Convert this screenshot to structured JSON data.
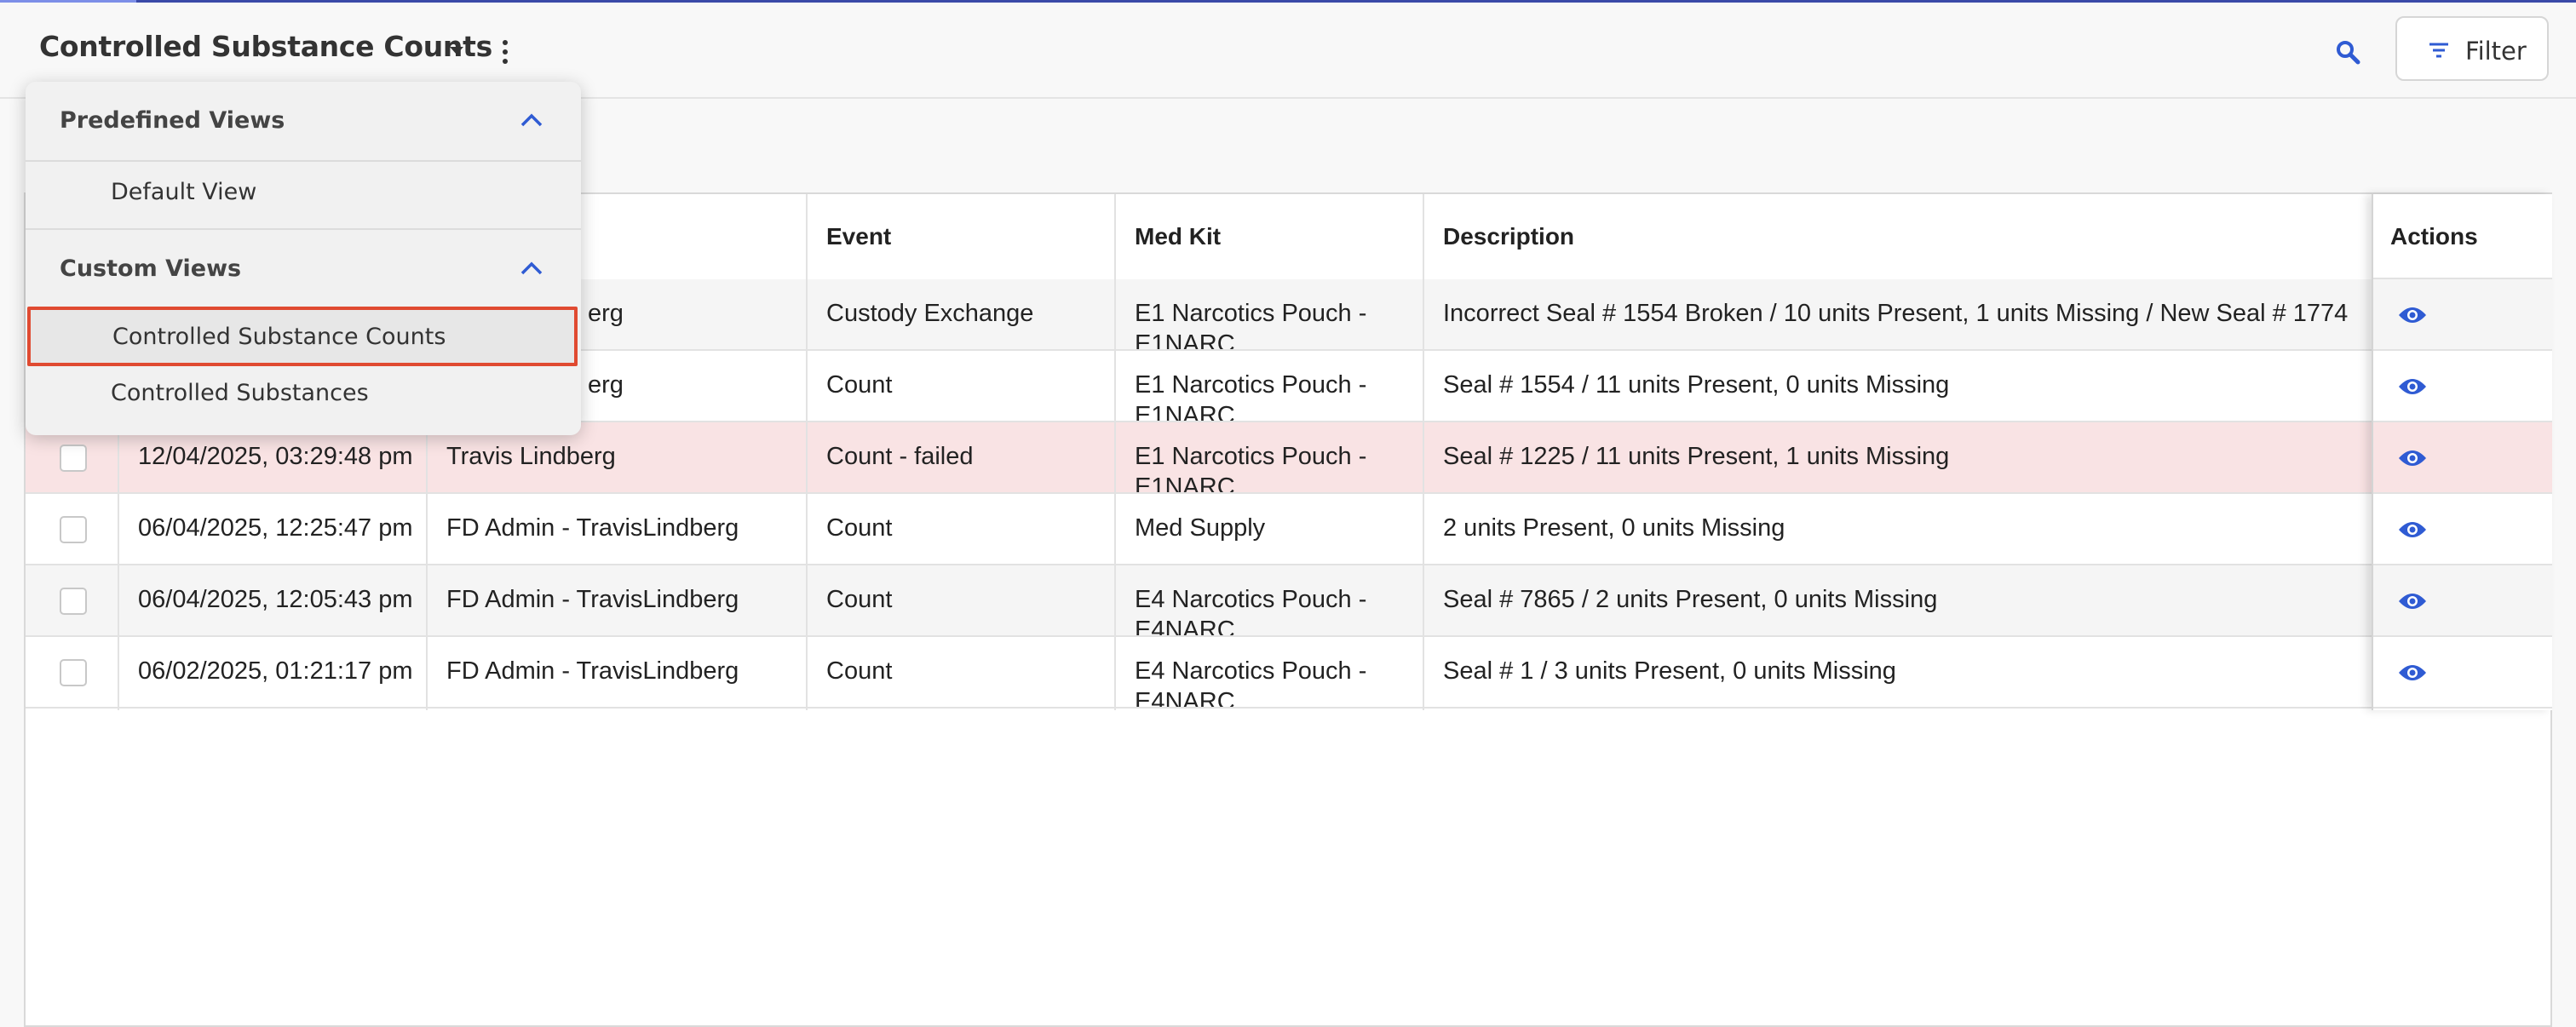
{
  "header": {
    "view_title": "Controlled Substance Counts",
    "filter_label": "Filter"
  },
  "menu": {
    "predefined_header": "Predefined Views",
    "predefined_items": [
      "Default View"
    ],
    "custom_header": "Custom Views",
    "custom_items": [
      "Controlled Substance Counts",
      "Controlled Substances"
    ],
    "selected": "Controlled Substance Counts"
  },
  "table": {
    "columns": {
      "event": "Event",
      "med_kit": "Med Kit",
      "description": "Description",
      "actions": "Actions"
    },
    "rows": [
      {
        "date": "",
        "user": "erg",
        "event": "Custody Exchange",
        "med_kit": "E1  Narcotics Pouch - E1NARC",
        "description": " Incorrect Seal # 1554 Broken  / 10 units Present, 1 units Missing / New Seal # 1774"
      },
      {
        "date": "",
        "user": "erg",
        "event": "Count",
        "med_kit": "E1  Narcotics Pouch - E1NARC",
        "description": "Seal # 1554 / 11 units Present, 0 units Missing"
      },
      {
        "date": "12/04/2025, 03:29:48 pm",
        "user": "Travis Lindberg",
        "event": "Count - failed",
        "med_kit": "E1  Narcotics Pouch - E1NARC",
        "description": "Seal # 1225 / 11 units Present, 1 units Missing"
      },
      {
        "date": "06/04/2025, 12:25:47 pm",
        "user": "FD Admin - TravisLindberg",
        "event": "Count",
        "med_kit": "Med Supply",
        "description": "2 units Present, 0 units Missing"
      },
      {
        "date": "06/04/2025, 12:05:43 pm",
        "user": "FD Admin - TravisLindberg",
        "event": "Count",
        "med_kit": "E4 Narcotics Pouch - E4NARC",
        "description": "Seal # 7865 / 2 units Present, 0 units Missing"
      },
      {
        "date": "06/02/2025, 01:21:17 pm",
        "user": "FD Admin - TravisLindberg",
        "event": "Count",
        "med_kit": "E4 Narcotics Pouch - E4NARC",
        "description": "Seal # 1 / 3 units Present, 0 units Missing"
      }
    ]
  },
  "colors": {
    "accent": "#2f5bd3",
    "failed_row": "#f9e3e4",
    "selected_outline": "#e04a31"
  },
  "icons": [
    "chevron-down-icon",
    "kebab-menu-icon",
    "search-icon",
    "filter-icon",
    "chevron-up-icon",
    "eye-icon"
  ]
}
